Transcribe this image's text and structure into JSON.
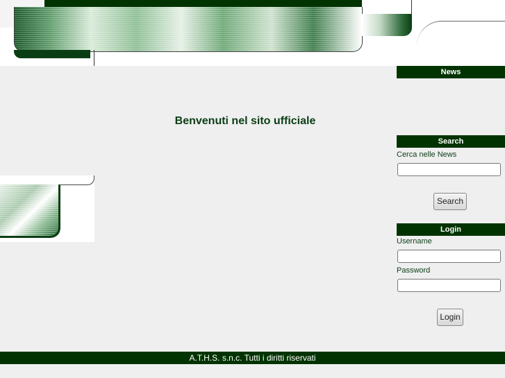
{
  "main": {
    "welcome": "Benvenuti nel sito ufficiale"
  },
  "sidebar": {
    "news": {
      "title": "News"
    },
    "search": {
      "title": "Search",
      "label": "Cerca nelle News",
      "input_value": "",
      "button_label": "Search"
    },
    "login": {
      "title": "Login",
      "username_label": "Username",
      "username_value": "",
      "password_label": "Password",
      "password_value": "",
      "button_label": "Login"
    }
  },
  "footer": {
    "text": "A.T.H.S. s.n.c. Tutti i diritti riservati"
  },
  "colors": {
    "brand_dark_green": "#003300",
    "text_green": "#0b3d15",
    "background": "#efefef"
  }
}
